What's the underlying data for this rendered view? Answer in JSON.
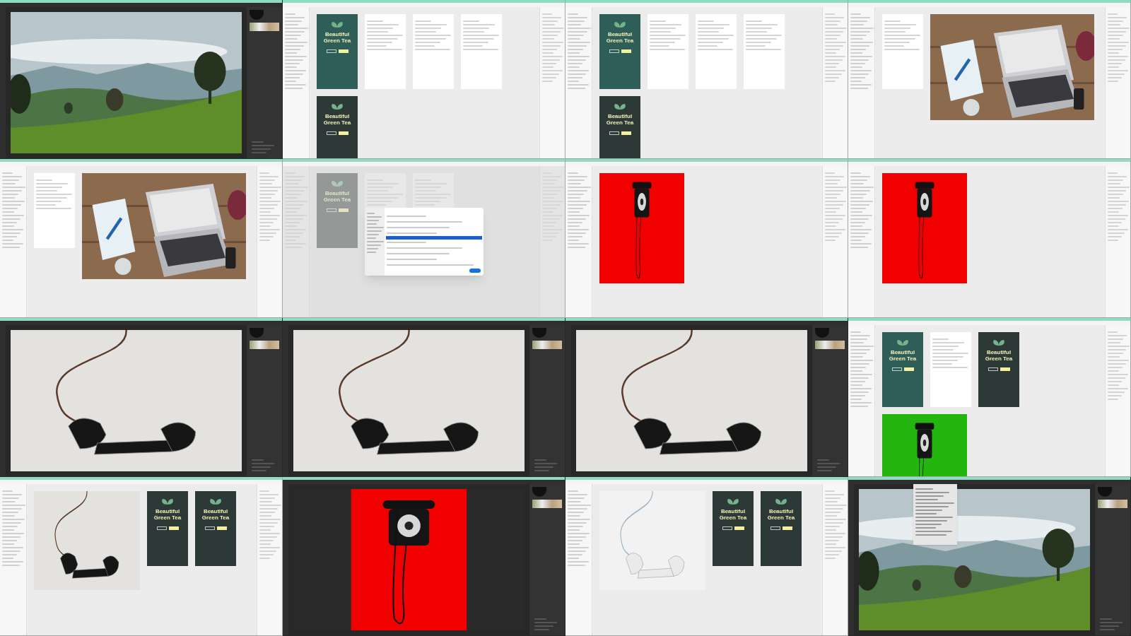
{
  "tiles": [
    {
      "kind": "photoshop",
      "canvas": {
        "kind": "landscape"
      }
    },
    {
      "kind": "sketch",
      "items": [
        {
          "kind": "tea-card",
          "title": "Beautiful Green Tea",
          "dark": false
        },
        {
          "kind": "artboard"
        },
        {
          "kind": "artboard"
        },
        {
          "kind": "artboard"
        },
        {
          "kind": "tea-card",
          "title": "Beautiful Green Tea",
          "dark": true
        }
      ]
    },
    {
      "kind": "sketch",
      "items": [
        {
          "kind": "tea-card",
          "title": "Beautiful Green Tea",
          "dark": false
        },
        {
          "kind": "artboard"
        },
        {
          "kind": "artboard"
        },
        {
          "kind": "artboard"
        },
        {
          "kind": "tea-card",
          "title": "Beautiful Green Tea",
          "dark": true
        }
      ]
    },
    {
      "kind": "sketch",
      "items": [
        {
          "kind": "artboard"
        },
        {
          "kind": "laptop-photo"
        }
      ]
    },
    {
      "kind": "sketch",
      "items": [
        {
          "kind": "artboard"
        },
        {
          "kind": "laptop-photo"
        }
      ]
    },
    {
      "kind": "sketch",
      "dimmed": true,
      "items": [
        {
          "kind": "tea-card",
          "title": "Beautiful Green Tea",
          "dark": true
        },
        {
          "kind": "artboard"
        },
        {
          "kind": "artboard"
        }
      ]
    },
    {
      "kind": "sketch",
      "items": [
        {
          "kind": "red-phone-photo"
        }
      ]
    },
    {
      "kind": "sketch",
      "items": [
        {
          "kind": "red-phone-photo"
        }
      ]
    },
    {
      "kind": "photoshop",
      "canvas": {
        "kind": "handset"
      }
    },
    {
      "kind": "photoshop",
      "canvas": {
        "kind": "handset"
      }
    },
    {
      "kind": "photoshop",
      "canvas": {
        "kind": "handset"
      }
    },
    {
      "kind": "sketch",
      "items": [
        {
          "kind": "tea-card",
          "title": "Beautiful Green Tea",
          "dark": false
        },
        {
          "kind": "artboard"
        },
        {
          "kind": "tea-card",
          "title": "Beautiful Green Tea",
          "dark": true
        },
        {
          "kind": "green-phone-photo"
        }
      ]
    },
    {
      "kind": "sketch",
      "items": [
        {
          "kind": "handset-photo"
        },
        {
          "kind": "tea-card",
          "title": "Beautiful Green Tea",
          "dark": true
        },
        {
          "kind": "tea-card",
          "title": "Beautiful Green Tea",
          "dark": true
        }
      ]
    },
    {
      "kind": "photoshop",
      "canvas": {
        "kind": "red-phone"
      }
    },
    {
      "kind": "sketch",
      "items": [
        {
          "kind": "white-handset-photo"
        },
        {
          "kind": "tea-card",
          "title": "Beautiful Green Tea",
          "dark": true
        },
        {
          "kind": "tea-card",
          "title": "Beautiful Green Tea",
          "dark": true
        }
      ]
    },
    {
      "kind": "photoshop",
      "menu_open": true,
      "canvas": {
        "kind": "landscape"
      }
    }
  ]
}
